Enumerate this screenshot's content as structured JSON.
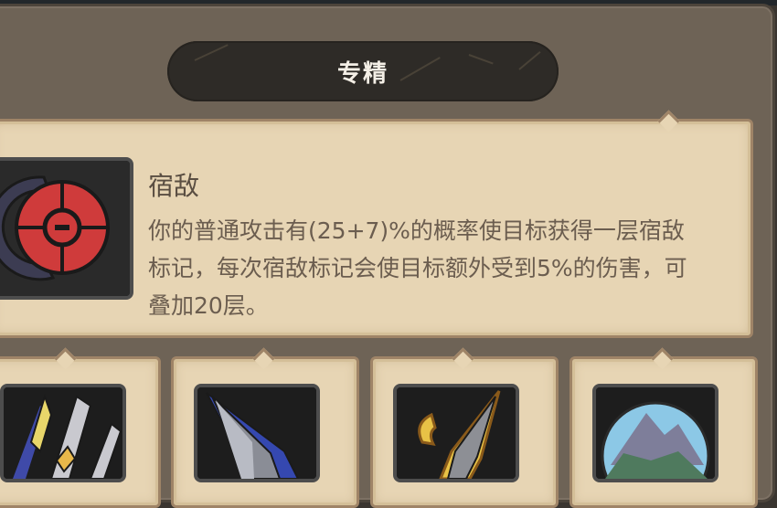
{
  "panel": {
    "title": "专精"
  },
  "skill": {
    "name": "宿敌",
    "description": "你的普通攻击有(25+7)%的概率使目标获得一层宿敌标记，每次宿敌标记会使目标额外受到5%的伤害，可叠加20层。",
    "icon": "nemesis-target-icon"
  },
  "specialization_slots": [
    {
      "icon": "daggers-icon"
    },
    {
      "icon": "blue-spear-icon"
    },
    {
      "icon": "golden-spear-icon"
    },
    {
      "icon": "mountain-icon"
    }
  ],
  "colors": {
    "window": "#6e6356",
    "banner": "#2e2b27",
    "parchment": "#e7d5b4",
    "target_red": "#cf3b3b"
  }
}
